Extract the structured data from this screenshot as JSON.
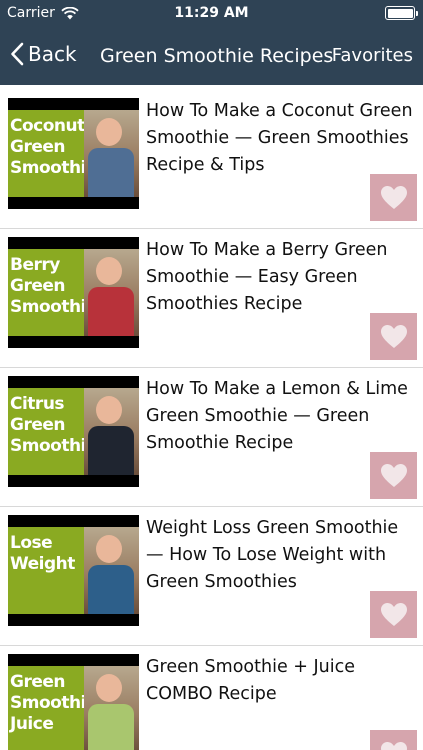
{
  "status_bar": {
    "carrier": "Carrier",
    "time": "11:29 AM",
    "battery_level": 1.0
  },
  "nav": {
    "back_label": "Back",
    "title": "Green Smoothie Recipes",
    "favorites_label": "Favorites"
  },
  "colors": {
    "nav_bg": "#2f4355",
    "thumb_green": "#8aaa22",
    "favorite_button": "#d6a5ad"
  },
  "items": [
    {
      "title": "How To Make a Coconut Green Smoothie — Green Smoothies Recipe & Tips",
      "thumb_lines": [
        "Coconut",
        "Green",
        "Smoothie"
      ],
      "icon": "heart-icon",
      "photo_body": "#4f6e94"
    },
    {
      "title": "How To Make a Berry Green Smoothie — Easy Green Smoothies Recipe",
      "thumb_lines": [
        "Berry",
        "Green",
        "Smoothie"
      ],
      "icon": "heart-icon",
      "photo_body": "#b8323a"
    },
    {
      "title": "How To Make a Lemon & Lime Green Smoothie — Green Smoothie Recipe",
      "thumb_lines": [
        "Citrus",
        "Green",
        "Smoothie"
      ],
      "icon": "heart-icon",
      "photo_body": "#1f2530"
    },
    {
      "title": "Weight Loss Green Smoothie — How To Lose Weight with Green Smoothies",
      "thumb_lines": [
        "Lose",
        "Weight"
      ],
      "icon": "heart-icon",
      "photo_body": "#2d5f8a"
    },
    {
      "title": "Green Smoothie + Juice COMBO Recipe",
      "thumb_lines": [
        "Green",
        "Smoothie",
        "Juice"
      ],
      "icon": "heart-icon",
      "photo_body": "#a9c66e"
    }
  ]
}
